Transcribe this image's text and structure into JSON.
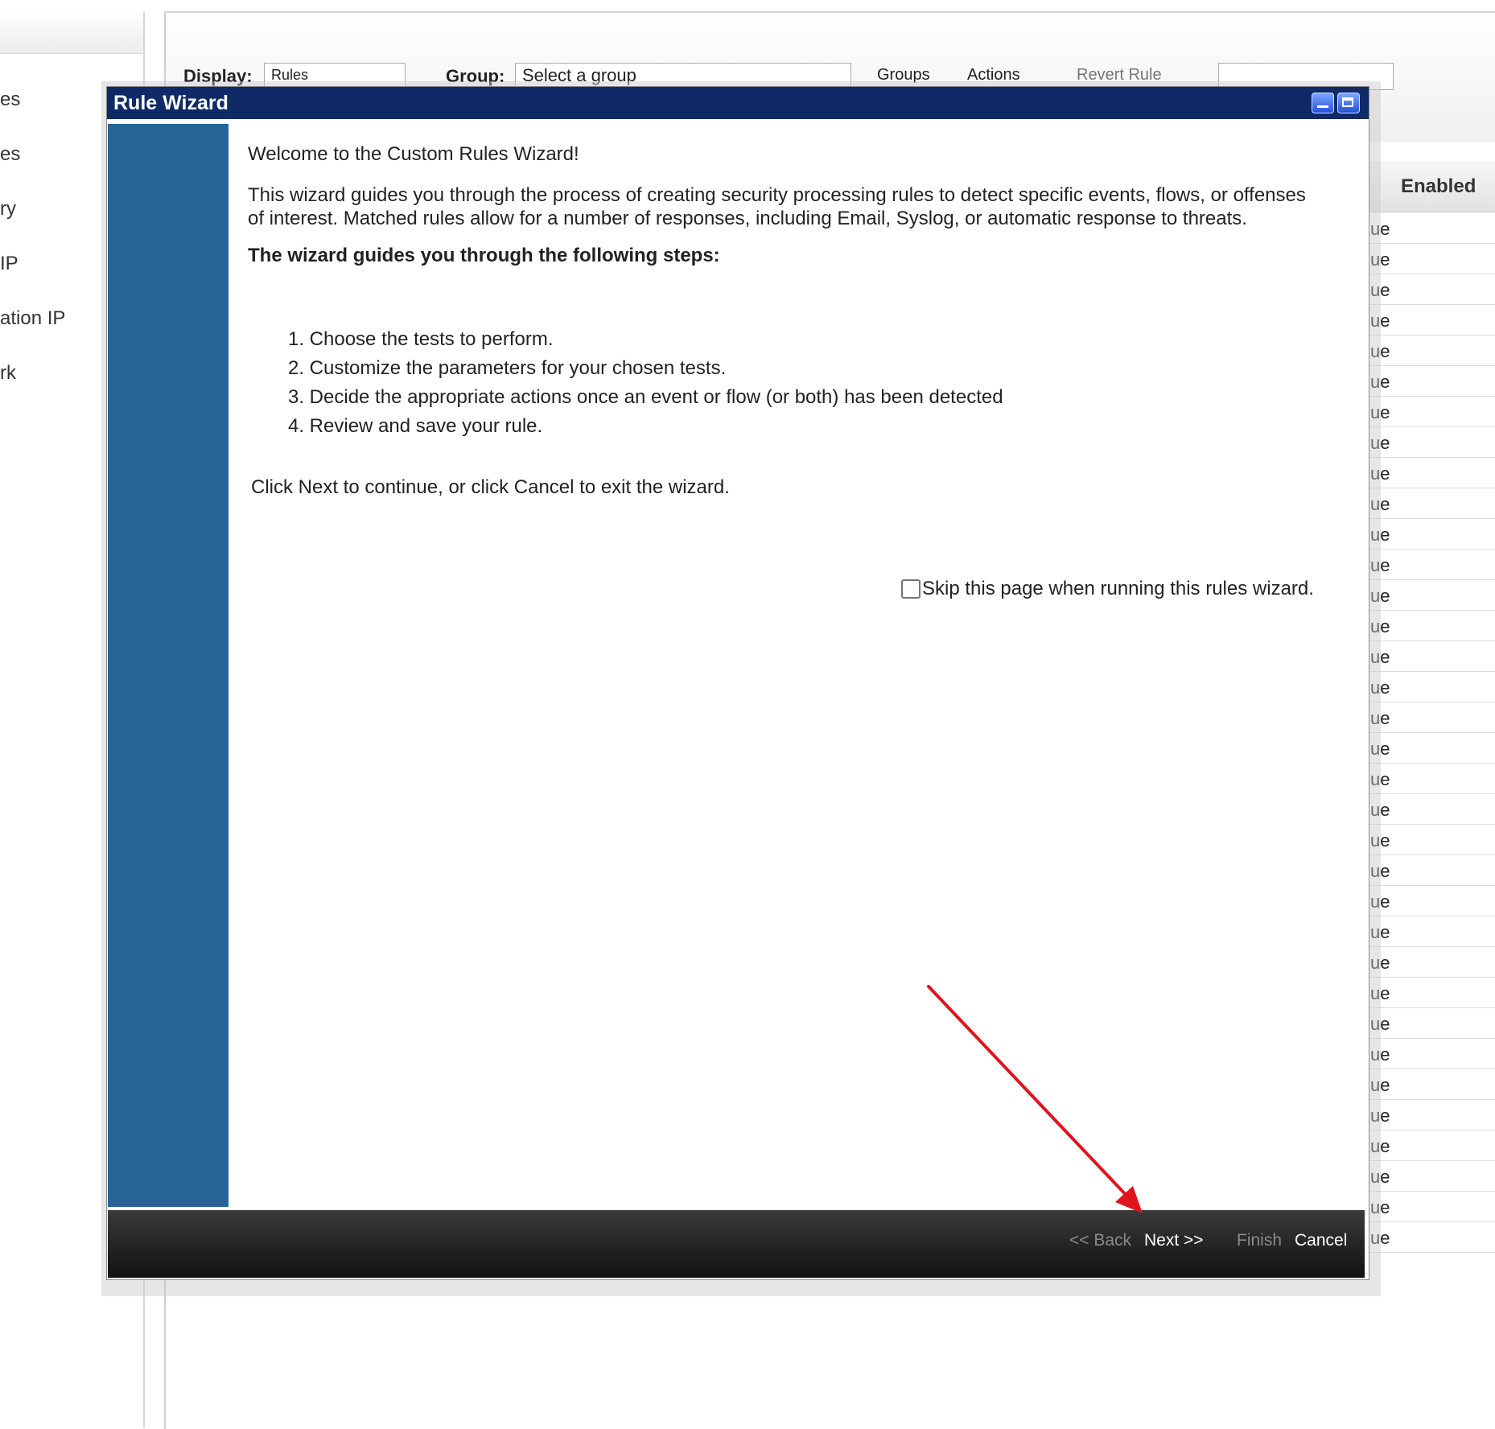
{
  "background": {
    "sidebar": {
      "items": [
        "es",
        "es",
        "ry",
        " IP",
        "ation IP",
        "rk"
      ]
    },
    "toolbar": {
      "display_label": "Display:",
      "display_value": "Rules",
      "group_label": "Group:",
      "group_value": "Select a group",
      "groups_label": "Groups",
      "actions_label": "Actions",
      "revert_label": "Revert Rule"
    },
    "table": {
      "header": "Enabled",
      "cell_text": "ue"
    }
  },
  "wizard": {
    "title": "Rule Wizard",
    "welcome": "Welcome to the Custom Rules Wizard!",
    "intro": "This wizard guides you through the process of creating security processing rules to detect specific events, flows, or offenses of interest. Matched rules allow for a number of responses, including Email, Syslog, or automatic response to threats.",
    "steps_heading": "The wizard guides you through the following steps:",
    "steps": [
      "1. Choose the tests to perform.",
      "2. Customize the parameters for your chosen tests.",
      "3. Decide the appropriate actions once an event or flow (or both) has been detected",
      "4. Review and save your rule."
    ],
    "continue_text": "Click Next to continue, or click Cancel to exit the wizard.",
    "skip_label": "Skip this page when running this rules wizard.",
    "skip_checked": false,
    "footer": {
      "back": "<< Back",
      "next": "Next >>",
      "finish": "Finish",
      "cancel": "Cancel"
    }
  },
  "colors": {
    "title_bar": "#0f2a66",
    "side_panel": "#276397",
    "annotation_arrow": "#e0141e"
  }
}
